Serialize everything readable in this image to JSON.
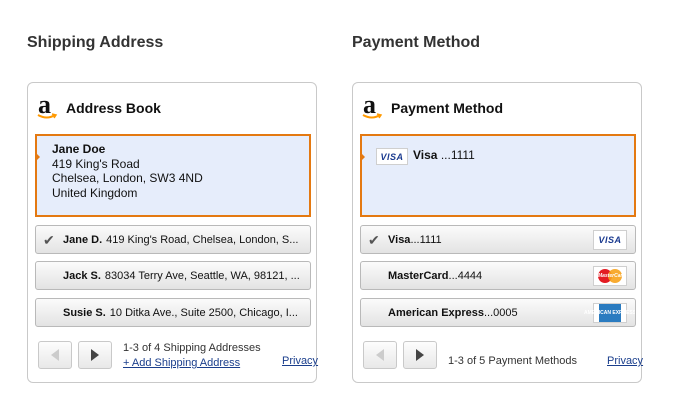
{
  "shipping": {
    "section_title": "Shipping Address",
    "widget_title": "Address Book",
    "selected": {
      "name": "Jane Doe",
      "line1": "419 King's Road",
      "line2": "Chelsea, London, SW3 4ND",
      "line3": "United Kingdom"
    },
    "items": [
      {
        "name": "Jane D.",
        "address": "419 King's Road, Chelsea, London, S...",
        "selected": true
      },
      {
        "name": "Jack S.",
        "address": "83034 Terry Ave, Seattle, WA, 98121, ...",
        "selected": false
      },
      {
        "name": "Susie S.",
        "address": "10 Ditka Ave., Suite 2500, Chicago, I...",
        "selected": false
      }
    ],
    "count_text": "1-3 of 4 Shipping Addresses",
    "add_link": "+ Add Shipping Address",
    "privacy": "Privacy"
  },
  "payment": {
    "section_title": "Payment Method",
    "widget_title": "Payment Method",
    "selected": {
      "card_logo": "VISA",
      "label": "Visa",
      "digits": "...1111"
    },
    "items": [
      {
        "name": "Visa",
        "digits": "...1111",
        "logo": "VISA",
        "icon": "visa-logo",
        "selected": true
      },
      {
        "name": "MasterCard",
        "digits": "...4444",
        "logo": "MasterCard",
        "icon": "mastercard-logo",
        "selected": false
      },
      {
        "name": "American Express",
        "digits": "...0005",
        "logo": "AMERICAN EXPRESS",
        "icon": "amex-logo",
        "selected": false
      }
    ],
    "count_text": "1-3 of 5 Payment Methods",
    "privacy": "Privacy"
  },
  "colors": {
    "accent": "#e47911",
    "selected_bg": "#e6edfb",
    "link": "#1a3e8c"
  },
  "logo_letter": "a"
}
